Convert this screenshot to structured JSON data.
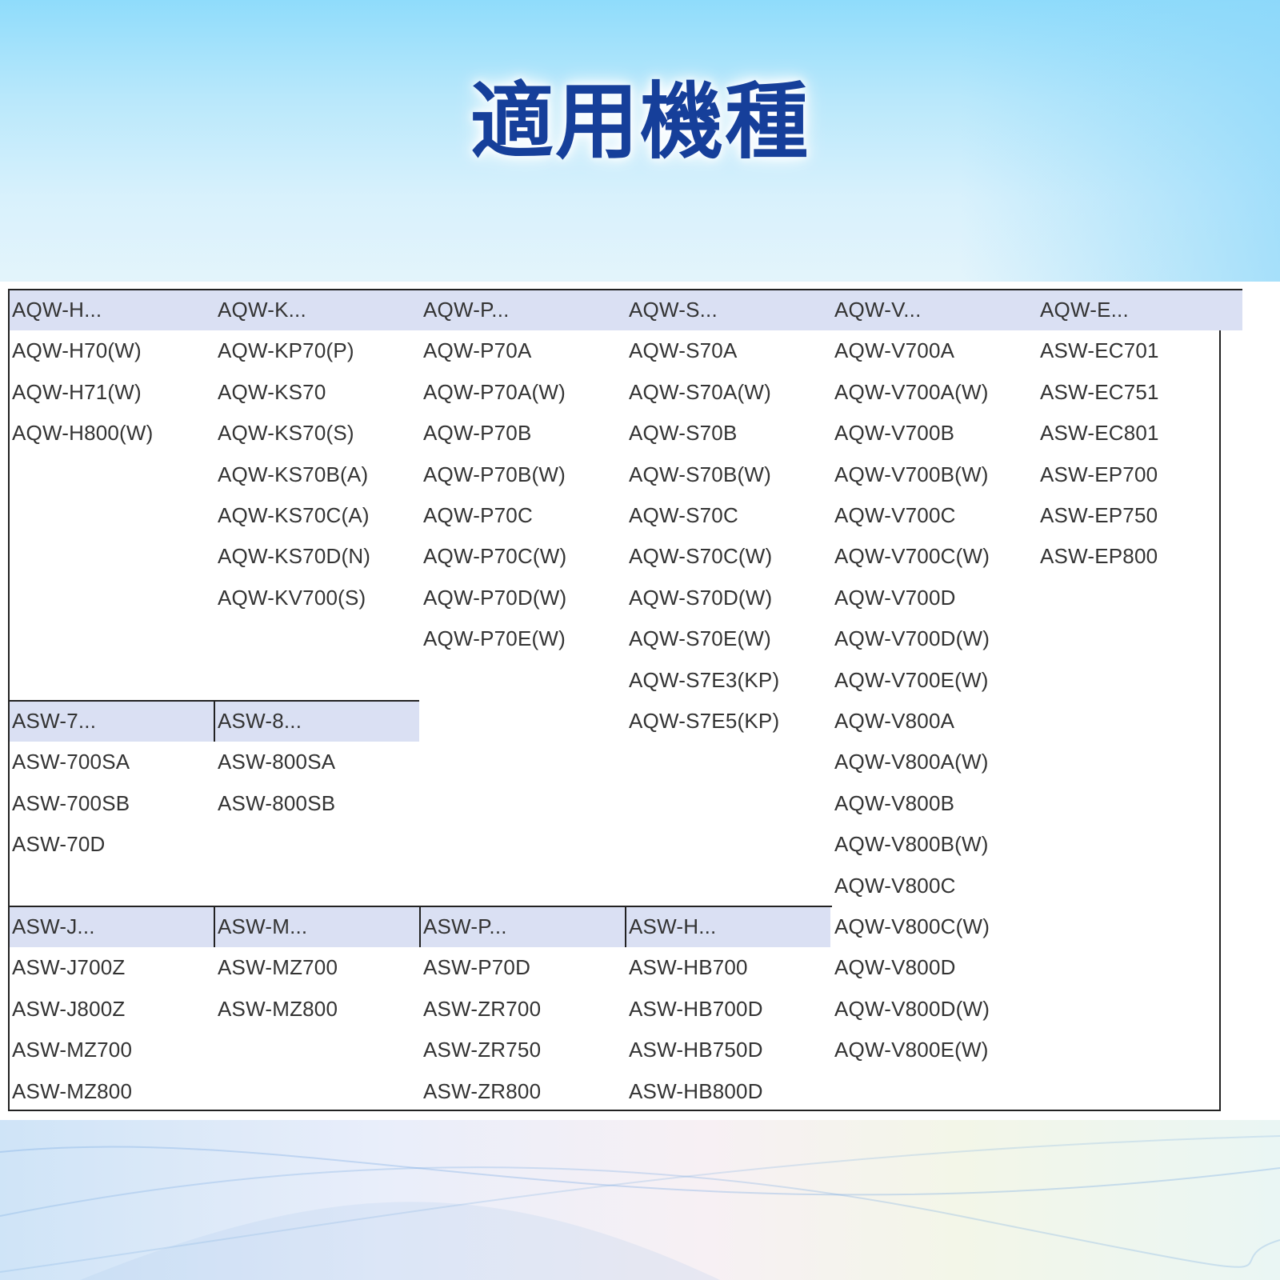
{
  "title": "適用機種",
  "sections": [
    {
      "groups": [
        {
          "header": "AQW-H...",
          "items": [
            "AQW-H70(W)",
            "AQW-H71(W)",
            "AQW-H800(W)"
          ]
        },
        {
          "header": "AQW-K...",
          "items": [
            "AQW-KP70(P)",
            "AQW-KS70",
            "AQW-KS70(S)",
            "AQW-KS70B(A)",
            "AQW-KS70C(A)",
            "AQW-KS70D(N)",
            "AQW-KV700(S)"
          ]
        },
        {
          "header": "AQW-P...",
          "items": [
            "AQW-P70A",
            "AQW-P70A(W)",
            "AQW-P70B",
            "AQW-P70B(W)",
            "AQW-P70C",
            "AQW-P70C(W)",
            "AQW-P70D(W)",
            "AQW-P70E(W)"
          ]
        },
        {
          "header": "AQW-S...",
          "items": [
            "AQW-S70A",
            "AQW-S70A(W)",
            "AQW-S70B",
            "AQW-S70B(W)",
            "AQW-S70C",
            "AQW-S70C(W)",
            "AQW-S70D(W)",
            "AQW-S70E(W)",
            "AQW-S7E3(KP)",
            "AQW-S7E5(KP)"
          ]
        },
        {
          "header": "AQW-V...",
          "items": [
            "AQW-V700A",
            "AQW-V700A(W)",
            "AQW-V700B",
            "AQW-V700B(W)",
            "AQW-V700C",
            "AQW-V700C(W)",
            "AQW-V700D",
            "AQW-V700D(W)",
            "AQW-V700E(W)",
            "AQW-V800A",
            "AQW-V800A(W)",
            "AQW-V800B",
            "AQW-V800B(W)",
            "AQW-V800C",
            "AQW-V800C(W)",
            "AQW-V800D",
            "AQW-V800D(W)",
            "AQW-V800E(W)"
          ]
        },
        {
          "header": "AQW-E...",
          "items": [
            "ASW-EC701",
            "ASW-EC751",
            "ASW-EC801",
            "ASW-EP700",
            "ASW-EP750",
            "ASW-EP800"
          ]
        }
      ]
    },
    {
      "groups": [
        {
          "header": "ASW-7...",
          "items": [
            "ASW-700SA",
            "ASW-700SB",
            "ASW-70D"
          ]
        },
        {
          "header": "ASW-8...",
          "items": [
            "ASW-800SA",
            "ASW-800SB"
          ]
        }
      ]
    },
    {
      "groups": [
        {
          "header": "ASW-J...",
          "items": [
            "ASW-J700Z",
            "ASW-J800Z",
            "ASW-MZ700",
            "ASW-MZ800"
          ]
        },
        {
          "header": "ASW-M...",
          "items": [
            "ASW-MZ700",
            "ASW-MZ800"
          ]
        },
        {
          "header": "ASW-P...",
          "items": [
            "ASW-P70D",
            "ASW-ZR700",
            "ASW-ZR750",
            "ASW-ZR800"
          ]
        },
        {
          "header": "ASW-H...",
          "items": [
            "ASW-HB700",
            "ASW-HB700D",
            "ASW-HB750D",
            "ASW-HB800D"
          ]
        }
      ]
    }
  ]
}
